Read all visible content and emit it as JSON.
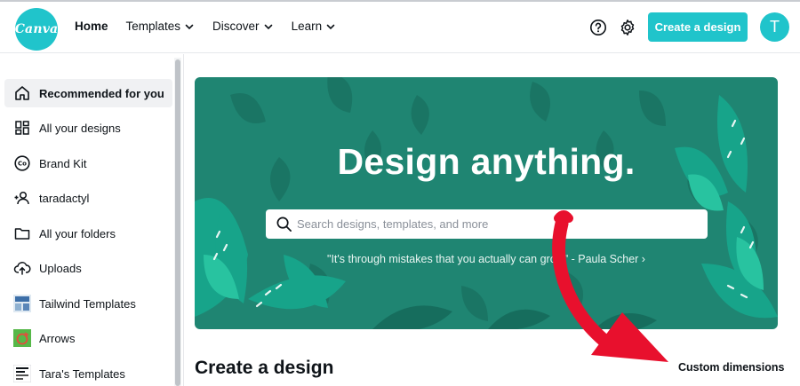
{
  "header": {
    "logo_text": "Canva",
    "nav": [
      {
        "label": "Home",
        "dropdown": false
      },
      {
        "label": "Templates",
        "dropdown": true
      },
      {
        "label": "Discover",
        "dropdown": true
      },
      {
        "label": "Learn",
        "dropdown": true
      }
    ],
    "help_icon": "help-circle-icon",
    "settings_icon": "gear-icon",
    "create_button": "Create a design",
    "avatar_initial": "T",
    "accent_color": "#20c4cb"
  },
  "sidebar": {
    "items": [
      {
        "label": "Recommended for you",
        "icon": "home-icon",
        "active": true
      },
      {
        "label": "All your designs",
        "icon": "grid-icon",
        "active": false
      },
      {
        "label": "Brand Kit",
        "icon": "brand-kit-icon",
        "active": false
      },
      {
        "label": "taradactyl",
        "icon": "team-icon",
        "active": false
      },
      {
        "label": "All your folders",
        "icon": "folder-icon",
        "active": false
      },
      {
        "label": "Uploads",
        "icon": "upload-icon",
        "active": false
      },
      {
        "label": "Tailwind Templates",
        "icon": "tailwind-thumbnail",
        "active": false
      },
      {
        "label": "Arrows",
        "icon": "arrows-thumbnail",
        "active": false
      },
      {
        "label": "Tara's Templates",
        "icon": "templates-thumbnail",
        "active": false
      }
    ]
  },
  "hero": {
    "title": "Design anything.",
    "search_placeholder": "Search designs, templates, and more",
    "quote": "\"It's through mistakes that you actually can grow\" - Paula Scher ›",
    "background_color": "#1f8572"
  },
  "create": {
    "title": "Create a design",
    "custom_dimensions": "Custom dimensions"
  },
  "annotation": {
    "arrow_color": "#e8102d"
  }
}
